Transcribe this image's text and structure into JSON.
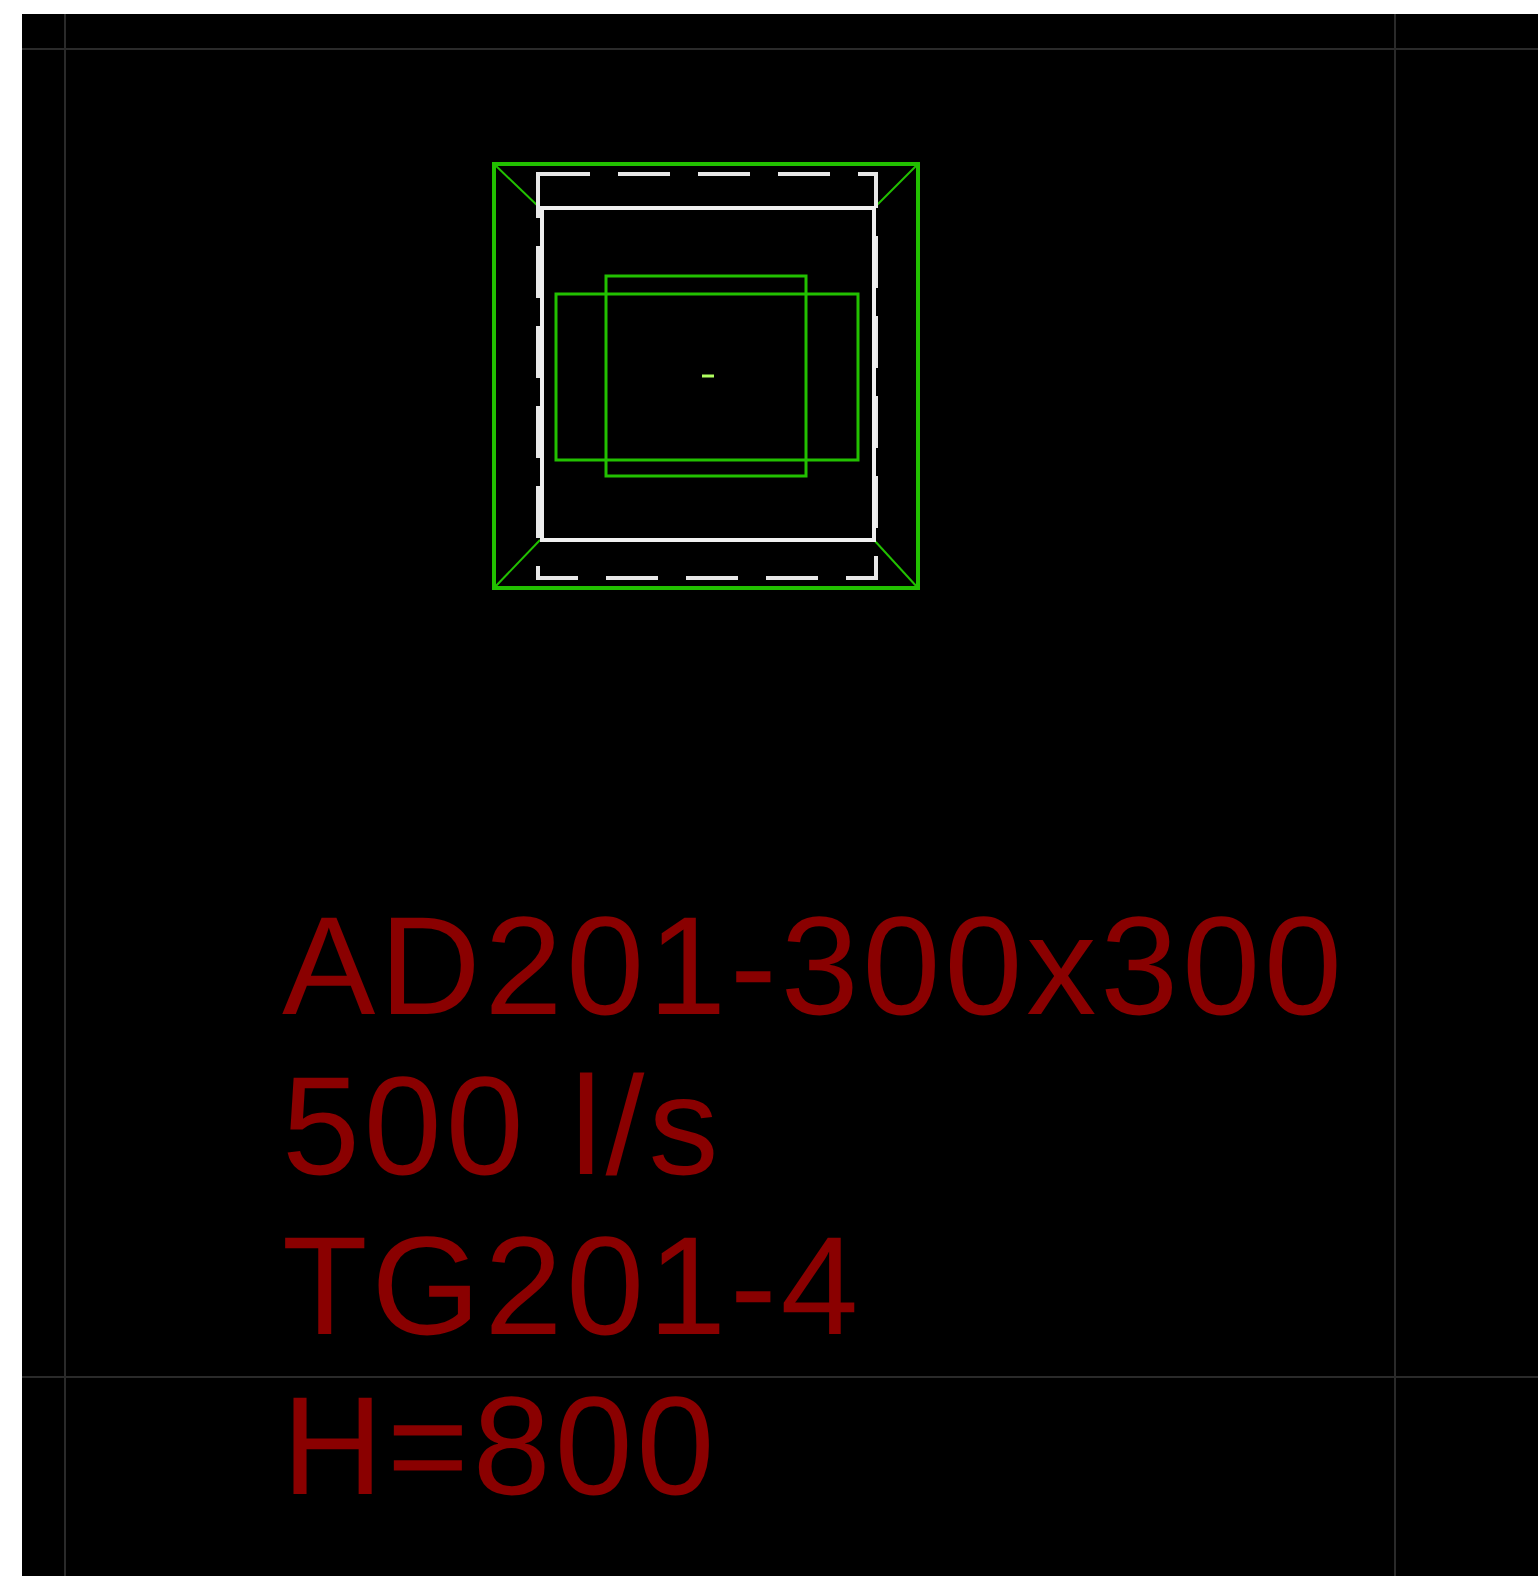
{
  "drawing": {
    "labels": [
      {
        "text": "AD201-300x300"
      },
      {
        "text": "500 l/s"
      },
      {
        "text": "TG201-4"
      },
      {
        "text": "H=800"
      }
    ]
  }
}
